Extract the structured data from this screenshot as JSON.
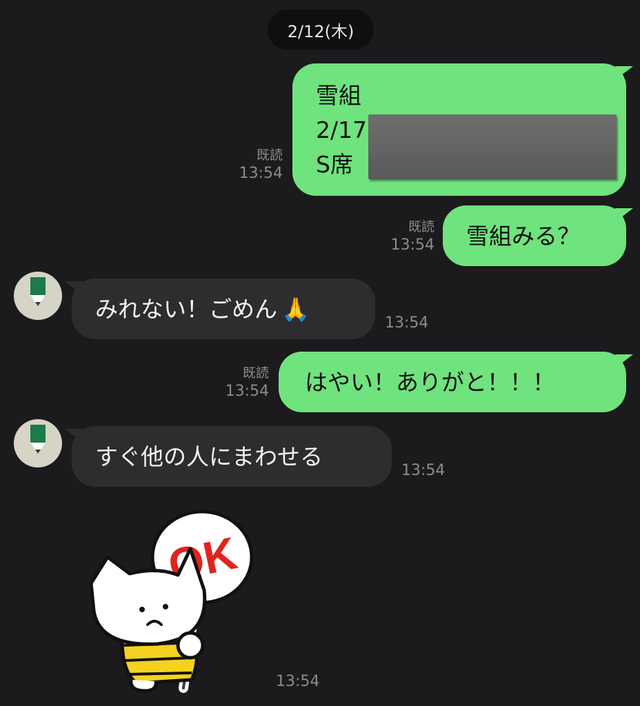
{
  "chat": {
    "date": "2/12(木)",
    "messages": [
      {
        "lines": [
          "雪組",
          "2/17",
          "S席"
        ],
        "read": "既読",
        "time": "13:54"
      },
      {
        "text": "雪組みる？",
        "read": "既読",
        "time": "13:54"
      },
      {
        "text": "みれない！ごめん",
        "emoji": "🙏",
        "time": "13:54"
      },
      {
        "text": "はやい！ありがと！！！",
        "read": "既読",
        "time": "13:54"
      },
      {
        "text": "すぐ他の人にまわせる",
        "time": "13:54"
      },
      {
        "sticker_text": "OK",
        "time": "13:54"
      }
    ]
  },
  "colors": {
    "background": "#1b1b1d",
    "outgoing_bubble": "#6fe37d",
    "incoming_bubble": "#2d2d2f",
    "meta_text": "#8c8c8c"
  },
  "icons": {
    "avatar": "green-pencil-avatar-icon",
    "emoji": "folded-hands-emoji",
    "sticker": "cat-ok-sign-sticker"
  }
}
